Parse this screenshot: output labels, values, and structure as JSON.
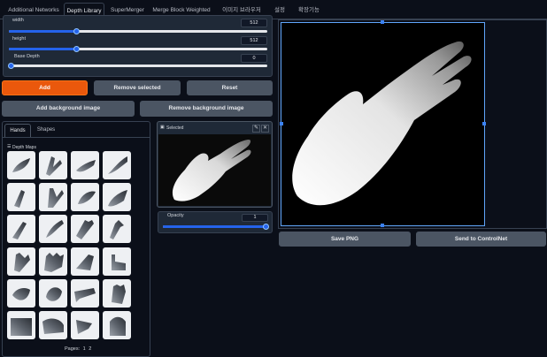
{
  "tabs": [
    "Additional Networks",
    "Depth Library",
    "SuperMerger",
    "Merge Block Weighted",
    "이미지 브라우저",
    "설정",
    "확장기능"
  ],
  "sliders": {
    "width": {
      "label": "width",
      "value": "512",
      "fraction": 0.26
    },
    "height": {
      "label": "height",
      "value": "512",
      "fraction": 0.26
    },
    "base_depth": {
      "label": "Base Depth",
      "value": "0",
      "fraction": 0.0
    }
  },
  "buttons": {
    "add": "Add",
    "remove_selected": "Remove selected",
    "reset": "Reset",
    "add_background": "Add background image",
    "remove_background": "Remove background image",
    "save_png": "Save PNG",
    "send_controlnet": "Send to ControlNet"
  },
  "library": {
    "tabs": [
      "Hands",
      "Shapes"
    ],
    "section_label": "Depth Maps",
    "pages_label": "Pages:",
    "pages": [
      "1",
      "2"
    ]
  },
  "selected": {
    "label": "Selected"
  },
  "opacity": {
    "label": "Opacity",
    "value": "1",
    "fraction": 1.0
  },
  "colors": {
    "accent": "#2563eb",
    "orange": "#ea580c",
    "background": "#0b0f19"
  }
}
